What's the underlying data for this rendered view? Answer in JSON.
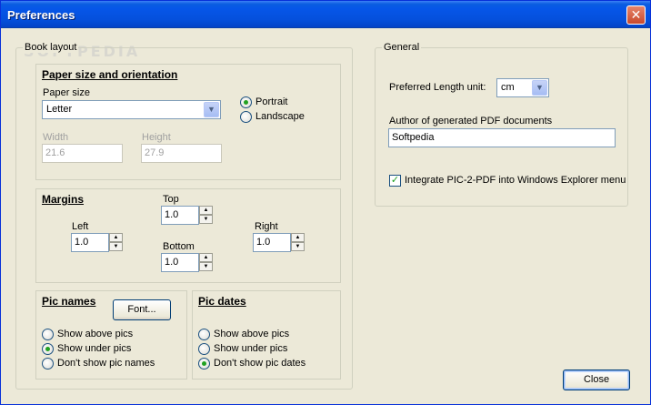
{
  "window": {
    "title": "Preferences",
    "close_glyph": "✕"
  },
  "watermark": "SOFTPEDIA",
  "book_layout": {
    "legend": "Book layout",
    "paper": {
      "header": "Paper size and orientation",
      "size_label": "Paper size",
      "size_value": "Letter",
      "orientation": [
        {
          "label": "Portrait",
          "selected": true
        },
        {
          "label": "Landscape",
          "selected": false
        }
      ],
      "width_label": "Width",
      "width_value": "21.6",
      "height_label": "Height",
      "height_value": "27.9"
    },
    "margins": {
      "header": "Margins",
      "top_label": "Top",
      "top_value": "1.0",
      "left_label": "Left",
      "left_value": "1.0",
      "right_label": "Right",
      "right_value": "1.0",
      "bottom_label": "Bottom",
      "bottom_value": "1.0"
    },
    "pic_names": {
      "header": "Pic names",
      "font_button": "Font...",
      "options": [
        {
          "label": "Show above pics",
          "selected": false
        },
        {
          "label": "Show under pics",
          "selected": true
        },
        {
          "label": "Don't show pic names",
          "selected": false
        }
      ]
    },
    "pic_dates": {
      "header": "Pic dates",
      "options": [
        {
          "label": "Show above pics",
          "selected": false
        },
        {
          "label": "Show under pics",
          "selected": false
        },
        {
          "label": "Don't show pic dates",
          "selected": true
        }
      ]
    }
  },
  "general": {
    "legend": "General",
    "length_unit_label": "Preferred Length unit:",
    "length_unit_value": "cm",
    "author_label": "Author of generated PDF documents",
    "author_value": "Softpedia",
    "integrate_label": "Integrate PIC-2-PDF into Windows Explorer menu",
    "integrate_checked": true
  },
  "close_button": "Close",
  "colors": {
    "title_bar": "#0556e0",
    "dialog_bg": "#ece9d8",
    "radio_dot": "#21a121"
  },
  "icons": {
    "dropdown": "chevron-down-icon",
    "spin_up": "arrow-up-icon",
    "spin_down": "arrow-down-icon",
    "close": "close-icon"
  }
}
